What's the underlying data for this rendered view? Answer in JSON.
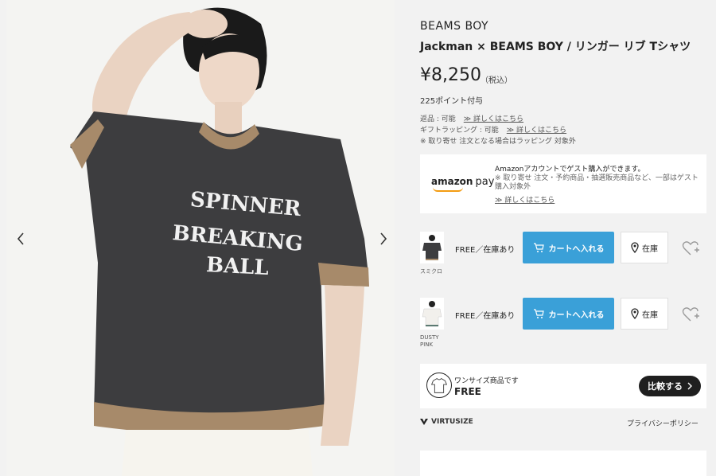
{
  "product": {
    "brand": "BEAMS BOY",
    "title": "Jackman × BEAMS BOY / リンガー リブ Tシャツ",
    "price": "¥8,250",
    "tax": "（税込）",
    "points": "225ポイント付与",
    "returns_label": "返品 : 可能",
    "returns_link": "≫ 詳しくはこちら",
    "gift_label": "ギフトラッピング : 可能",
    "gift_link": "≫ 詳しくはこちら",
    "order_note": "※ 取り寄せ 注文となる場合はラッピング 対象外"
  },
  "shirt_print": [
    "SPINNER",
    "BREAKING",
    "BALL"
  ],
  "amazon": {
    "logo": "amazon",
    "logo_pay": "pay",
    "heading": "Amazonアカウントでゲスト購入ができます。",
    "note": "※ 取り寄せ 注文・予約商品・抽選販売商品など、一部はゲスト購入対象外",
    "link": "≫ 詳しくはこちら"
  },
  "variants": [
    {
      "color_label": "スミクロ",
      "stock": "FREE／在庫あり",
      "cart": "カートへ入れる",
      "store": "在庫"
    },
    {
      "color_label": "DUSTY PINK",
      "stock": "FREE／在庫あり",
      "cart": "カートへ入れる",
      "store": "在庫"
    }
  ],
  "compare": {
    "subtitle": "ワンサイズ商品です",
    "main": "FREE",
    "button": "比較する"
  },
  "footer": {
    "virtusize": "VIRTUSIZE",
    "privacy": "プライバシーポリシー"
  },
  "colors": {
    "cart_button": "#3aa0d8",
    "compare_button": "#1f1f1f",
    "shirt_body": "#3d3d3f",
    "shirt_trim": "#a78a6a"
  },
  "icons": [
    "chevron-left-icon",
    "chevron-right-icon",
    "cart-icon",
    "location-pin-icon",
    "heart-plus-icon",
    "virtusize-logo-icon"
  ]
}
